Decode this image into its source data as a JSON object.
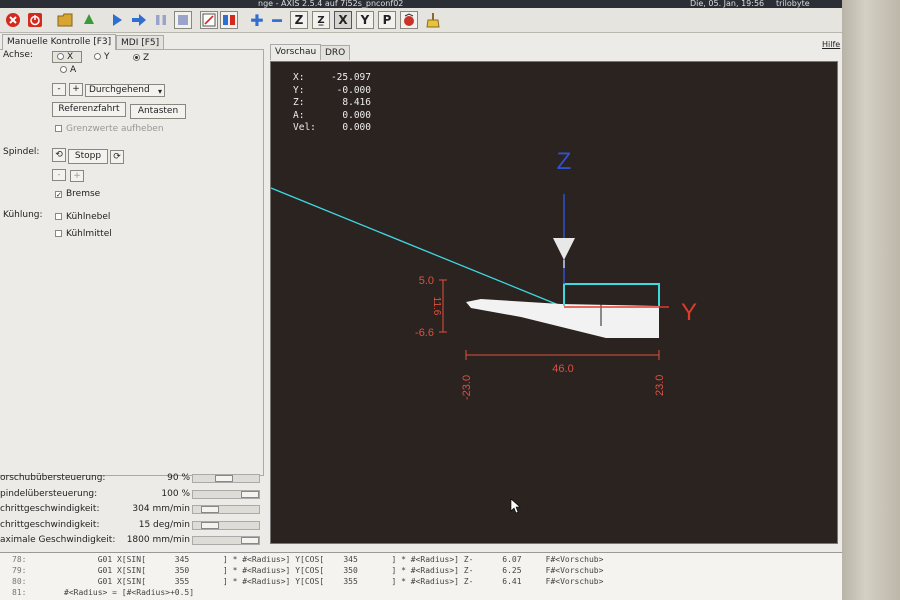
{
  "topbar": {
    "title": "nge - AXIS 2.5.4 auf  7i52s_pnconf02",
    "clock": "Die, 05. Jan, 19:56",
    "user": "trilobyte"
  },
  "menu": {
    "help": "Hilfe"
  },
  "left_tabs": [
    "Manuelle Kontrolle [F3]",
    "MDI [F5]"
  ],
  "manual": {
    "axis_label": "Achse:",
    "axes": [
      "X",
      "Y",
      "Z",
      "A"
    ],
    "selected_axis": "Z",
    "minus": "-",
    "plus": "+",
    "jog_mode": "Durchgehend",
    "home_button": "Referenzfahrt",
    "touch_off_button": "Antasten",
    "override_limits": "Grenzwerte aufheben",
    "spindle_label": "Spindel:",
    "spindle_stop": "Stopp",
    "brake": "Bremse",
    "cooling_label": "Kühlung:",
    "mist": "Kühlnebel",
    "flood": "Kühlmittel"
  },
  "overrides": [
    {
      "name": "orschubübersteuerung:",
      "value": "90 %",
      "level": 0.45
    },
    {
      "name": "pindelübersteuerung:",
      "value": "100 %",
      "level": 1.0
    },
    {
      "name": "chrittgeschwindigkeit:",
      "value": "304 mm/min",
      "level": 0.17
    },
    {
      "name": "chrittgeschwindigkeit:",
      "value": "15 deg/min",
      "level": 0.17
    },
    {
      "name": "aximale Geschwindigkeit:",
      "value": "1800 mm/min",
      "level": 1.0
    }
  ],
  "right_tabs": [
    "Vorschau",
    "DRO"
  ],
  "dro": [
    {
      "axis": "X:",
      "value": "-25.097"
    },
    {
      "axis": "Y:",
      "value": "-0.000"
    },
    {
      "axis": "Z:",
      "value": "8.416"
    },
    {
      "axis": "A:",
      "value": "0.000"
    },
    {
      "axis": "Vel:",
      "value": "0.000"
    }
  ],
  "preview": {
    "z_axis_label": "Z",
    "y_axis_label": "Y",
    "dim_top": "5.0",
    "dim_bottom": "-6.6",
    "dim_height": "11.6",
    "dim_left": "-23.0",
    "dim_width": "46.0",
    "dim_right": "23.0",
    "colors": {
      "axis_blue": "#3050d0",
      "axis_red": "#e03a2a",
      "path_cyan": "#3ed8e0",
      "background": "#2a2320",
      "dimension": "#e05040"
    }
  },
  "gcode": [
    {
      "line": "78:",
      "code": "       G01 X[SIN[      345       ] * #<Radius>] Y[COS[    345       ] * #<Radius>] Z-      6.07     F#<Vorschub>"
    },
    {
      "line": "79:",
      "code": "       G01 X[SIN[      350       ] * #<Radius>] Y[COS[    350       ] * #<Radius>] Z-      6.25     F#<Vorschub>"
    },
    {
      "line": "80:",
      "code": "       G01 X[SIN[      355       ] * #<Radius>] Y[COS[    355       ] * #<Radius>] Z-      6.41     F#<Vorschub>"
    },
    {
      "line": "81:",
      "code": "#<Radius> = [#<Radius>+0.5]"
    }
  ]
}
